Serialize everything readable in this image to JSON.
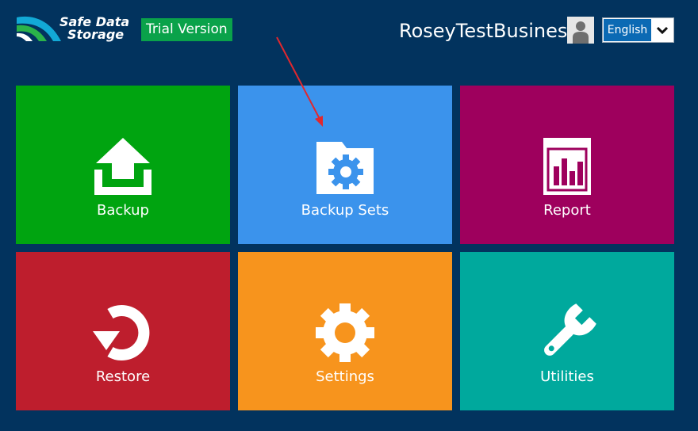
{
  "brand": {
    "name_line1": "Safe Data",
    "name_line2": "Storage",
    "edition_badge": "Trial Version"
  },
  "header": {
    "account_name": "RoseyTestBusiness",
    "language": {
      "selected": "English"
    }
  },
  "tiles": [
    {
      "label": "Backup",
      "icon": "upload-icon",
      "color": "#00a410"
    },
    {
      "label": "Backup Sets",
      "icon": "folder-gear-icon",
      "color": "#3b93ec"
    },
    {
      "label": "Report",
      "icon": "bar-chart-icon",
      "color": "#9e005d"
    },
    {
      "label": "Restore",
      "icon": "restore-icon",
      "color": "#be1e2d"
    },
    {
      "label": "Settings",
      "icon": "gear-icon",
      "color": "#f7941d"
    },
    {
      "label": "Utilities",
      "icon": "wrench-icon",
      "color": "#00a99d"
    }
  ],
  "colors": {
    "background": "#02335e",
    "annotation_arrow": "#e0282e"
  }
}
